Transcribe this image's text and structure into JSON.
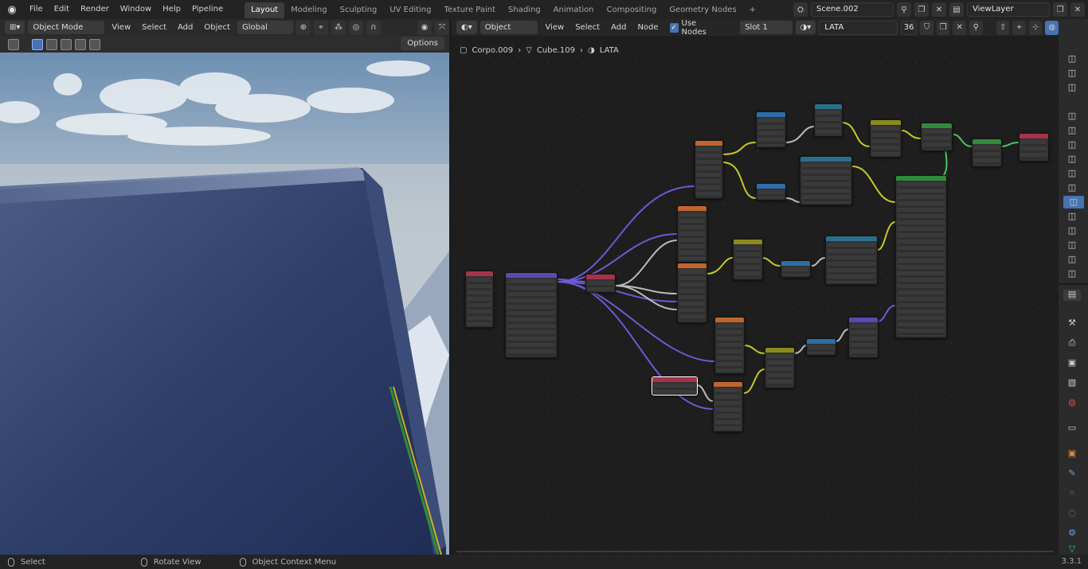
{
  "topbar": {
    "menus": [
      "File",
      "Edit",
      "Render",
      "Window",
      "Help",
      "Pipeline"
    ],
    "workspaces": [
      "Layout",
      "Modeling",
      "Sculpting",
      "UV Editing",
      "Texture Paint",
      "Shading",
      "Animation",
      "Compositing",
      "Geometry Nodes"
    ],
    "add_tab": "+",
    "scene": "Scene.002",
    "view_layer": "ViewLayer"
  },
  "viewport": {
    "mode": "Object Mode",
    "menus": [
      "View",
      "Select",
      "Add",
      "Object"
    ],
    "transform": "Global",
    "options": "Options"
  },
  "node_editor": {
    "type": "Object",
    "menus": [
      "View",
      "Select",
      "Add",
      "Node"
    ],
    "use_nodes": "Use Nodes",
    "slot": "Slot 1",
    "material": "LATA",
    "users": "36",
    "breadcrumb": [
      "Corpo.009",
      "Cube.109",
      "LATA"
    ]
  },
  "status": {
    "select": "Select",
    "rotate": "Rotate View",
    "context": "Object Context Menu",
    "version": "3.3.1"
  },
  "colors": {
    "accent": "#4772b3",
    "node_orange": "#c1652c",
    "node_blue": "#2d6ea8",
    "node_teal": "#2a6f8a",
    "node_yellow": "#8a8a1e",
    "node_green": "#2f8c3a",
    "node_purple": "#5a4ab0",
    "node_red": "#a8324a",
    "wire_purple": "#6b5bd6",
    "wire_yellow": "#c8c82a",
    "wire_grey": "#bdbdbd",
    "wire_green": "#49c46a"
  }
}
